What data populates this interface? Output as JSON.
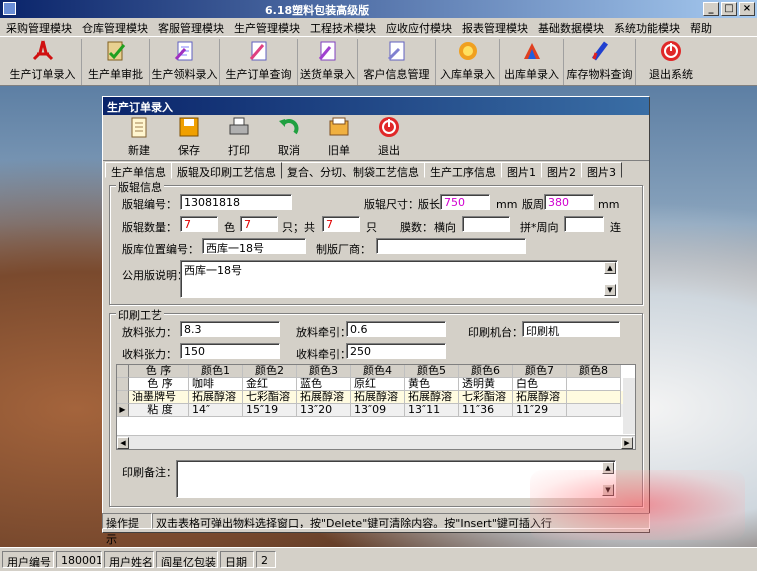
{
  "app": {
    "title": "6.18塑料包装高级版"
  },
  "menu": [
    "采购管理模块",
    "仓库管理模块",
    "客服管理模块",
    "生产管理模块",
    "工程技术模块",
    "应收应付模块",
    "报表管理模块",
    "基础数据模块",
    "系统功能模块",
    "帮助"
  ],
  "toolbar": [
    {
      "label": "生产订单录入",
      "icon": "pdf-icon"
    },
    {
      "label": "生产单审批",
      "icon": "approve-icon"
    },
    {
      "label": "生产领料录入",
      "icon": "pick-icon"
    },
    {
      "label": "生产订单查询",
      "icon": "query-icon"
    },
    {
      "label": "送货单录入",
      "icon": "delivery-icon"
    },
    {
      "label": "客户信息管理",
      "icon": "customer-icon"
    },
    {
      "label": "入库单录入",
      "icon": "inbound-icon"
    },
    {
      "label": "出库单录入",
      "icon": "outbound-icon"
    },
    {
      "label": "库存物料查询",
      "icon": "stock-icon"
    },
    {
      "label": "退出系统",
      "icon": "exit-icon"
    }
  ],
  "window": {
    "title": "生产订单录入",
    "toolbar": [
      "新建",
      "保存",
      "打印",
      "取消",
      "旧单",
      "退出"
    ],
    "tabs": [
      "生产单信息",
      "版辊及印刷工艺信息",
      "复合、分切、制袋工艺信息",
      "生产工序信息",
      "图片1",
      "图片2",
      "图片3"
    ]
  },
  "roller": {
    "group": "版辊信息",
    "code_label": "版辊编号：",
    "code": "13081818",
    "size_label": "版辊尺寸：",
    "len_label": "版长",
    "len": "750",
    "mm1": "mm",
    "width_label": "版周",
    "width": "380",
    "mm2": "mm",
    "qty_label": "版辊数量：",
    "qty": "7",
    "color_label": "色",
    "color_qty": "7",
    "zhi_label": "只；共",
    "total": "7",
    "zhi2_label": "只",
    "film_label": "膜数：",
    "horiz_label": "横向",
    "pin_label": "拼*周向",
    "lian_label": "连",
    "loc_label": "版库位置编号：",
    "loc": "西库一18号",
    "maker_label": "制版厂商：",
    "maker": "",
    "note_label": "公用版说明：",
    "note": "西库一18号"
  },
  "print": {
    "group": "印刷工艺",
    "unwind_label": "放料张力：",
    "unwind": "8.3",
    "unwind_pull_label": "放料牵引：",
    "unwind_pull": "0.6",
    "machine_label": "印刷机台：",
    "machine": "印刷机",
    "rewind_label": "收料张力：",
    "rewind": "150",
    "rewind_pull_label": "收料牵引：",
    "rewind_pull": "250",
    "headers": [
      "色 序",
      "颜色1",
      "颜色2",
      "颜色3",
      "颜色4",
      "颜色5",
      "颜色6",
      "颜色7",
      "颜色8"
    ],
    "rows": [
      [
        "色 序",
        "咖啡",
        "金红",
        "蓝色",
        "原红",
        "黄色",
        "透明黄",
        "白色",
        ""
      ],
      [
        "油墨牌号",
        "拓展醇溶",
        "七彩酯溶",
        "拓展醇溶",
        "拓展醇溶",
        "拓展醇溶",
        "七彩酯溶",
        "拓展醇溶",
        ""
      ],
      [
        "粘 度",
        "14″",
        "15″19",
        "13″20",
        "13″09",
        "13″11",
        "11″36",
        "11″29",
        ""
      ]
    ],
    "remark_label": "印刷备注："
  },
  "hint": {
    "label": "操作提示",
    "text": "双击表格可弹出物料选择窗口，按\"Delete\"键可清除内容。按\"Insert\"键可插入行"
  },
  "status": [
    "用户编号",
    "180001",
    "用户姓名",
    "阎星亿包装",
    "日期",
    "2"
  ]
}
